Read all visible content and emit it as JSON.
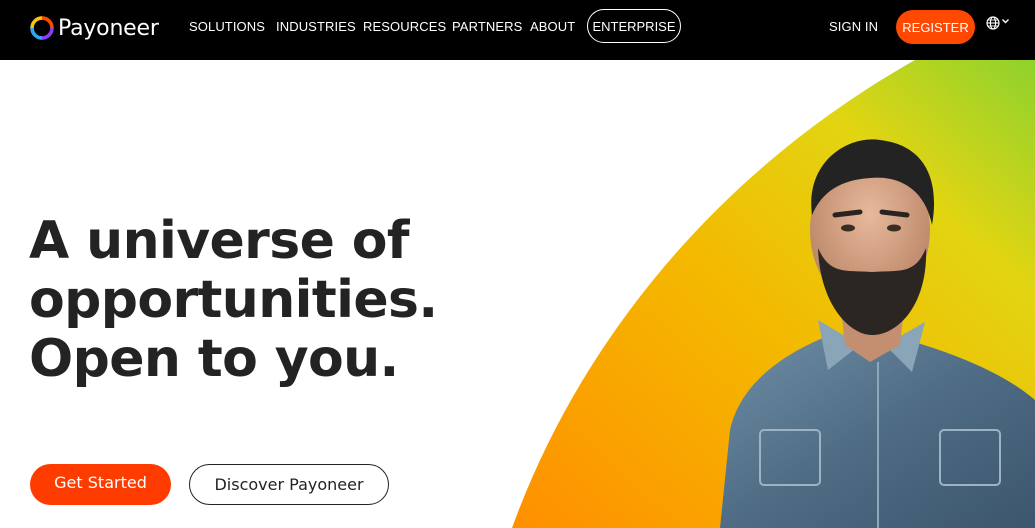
{
  "header": {
    "brand": "Payoneer",
    "nav": [
      {
        "id": "solutions",
        "label": "SOLUTIONS"
      },
      {
        "id": "industries",
        "label": "INDUSTRIES"
      },
      {
        "id": "resources",
        "label": "RESOURCES"
      },
      {
        "id": "partners",
        "label": "PARTNERS"
      },
      {
        "id": "about",
        "label": "ABOUT"
      }
    ],
    "enterprise_label": "ENTERPRISE",
    "sign_in_label": "SIGN IN",
    "register_label": "REGISTER",
    "language_icon": "globe-icon"
  },
  "hero": {
    "headline_lines": [
      "A universe of",
      "opportunities.",
      "Open to you."
    ],
    "primary_cta": "Get Started",
    "secondary_cta": "Discover Payoneer"
  },
  "colors": {
    "topbar": "#000000",
    "accent": "#ff4800",
    "headline": "#232323",
    "gradient_start": "#ff9900",
    "gradient_mid": "#f2c500",
    "gradient_end": "#99d52a"
  }
}
